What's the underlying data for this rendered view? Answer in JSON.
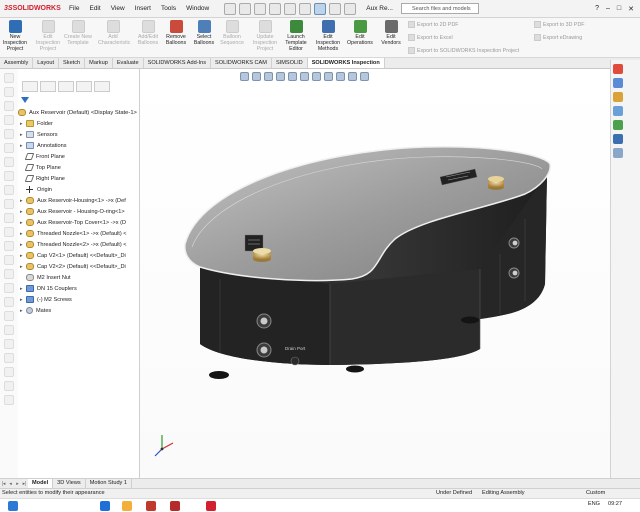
{
  "app": {
    "brand": "SOLIDWORKS",
    "doc_title": "Aux Re..."
  },
  "menu": [
    "File",
    "Edit",
    "View",
    "Insert",
    "Tools",
    "Window"
  ],
  "search": {
    "placeholder": "Search files and models"
  },
  "ribbon": {
    "buttons": [
      {
        "label": "New Inspection Project",
        "enabled": true
      },
      {
        "label": "Edit Inspection Project",
        "enabled": false
      },
      {
        "label": "Create New Template",
        "enabled": false
      },
      {
        "label": "Add Characteristic",
        "enabled": false
      },
      {
        "label": "Add/Edit Balloons",
        "enabled": false
      },
      {
        "label": "Remove Balloons",
        "enabled": true
      },
      {
        "label": "Select Balloons",
        "enabled": true
      },
      {
        "label": "Balloon Sequence",
        "enabled": false
      },
      {
        "label": "Update Inspection Project",
        "enabled": false
      },
      {
        "label": "Launch Template Editor",
        "enabled": true
      },
      {
        "label": "Edit Inspection Methods",
        "enabled": true
      },
      {
        "label": "Edit Operations",
        "enabled": true
      },
      {
        "label": "Edit Vendors",
        "enabled": true
      }
    ],
    "links": [
      "Export to 2D PDF",
      "Export to Excel",
      "Export to SOLIDWORKS Inspection Project",
      "Export to 3D PDF",
      "Export eDrawing"
    ]
  },
  "tabs": [
    "Assembly",
    "Layout",
    "Sketch",
    "Markup",
    "Evaluate",
    "SOLIDWORKS Add-Ins",
    "SOLIDWORKS CAM",
    "SIMSOLID",
    "SOLIDWORKS Inspection"
  ],
  "active_tab": "SOLIDWORKS Inspection",
  "tree": {
    "root": "Aux Reservoir (Default) <Display State-1>",
    "items": [
      {
        "label": "Folder",
        "icon": "folder"
      },
      {
        "label": "Sensors",
        "icon": "sensor"
      },
      {
        "label": "Annotations",
        "icon": "annot"
      },
      {
        "label": "Front Plane",
        "icon": "plane"
      },
      {
        "label": "Top Plane",
        "icon": "plane"
      },
      {
        "label": "Right Plane",
        "icon": "plane"
      },
      {
        "label": "Origin",
        "icon": "origin"
      },
      {
        "label": "Aux Reservoir-Housing<1> ->x (Def",
        "icon": "part"
      },
      {
        "label": "Aux Reservoir - Housing-O-ring<1>",
        "icon": "part"
      },
      {
        "label": "Aux Reservoir-Top Cover<1> ->x (D",
        "icon": "part"
      },
      {
        "label": "Threaded Nozzle<1> ->x (Default) <",
        "icon": "part"
      },
      {
        "label": "Threaded Nozzle<2> ->x (Default) <",
        "icon": "part"
      },
      {
        "label": "Cap V2<1> (Default) <<Default>_Di",
        "icon": "part"
      },
      {
        "label": "Cap V2<2> (Default) <<Default>_Di",
        "icon": "part"
      },
      {
        "label": "M2 Insert Nut",
        "icon": "part-g"
      },
      {
        "label": "DN 15 Couplers",
        "icon": "blue"
      },
      {
        "label": "(-) M2 Screws",
        "icon": "blue"
      },
      {
        "label": "Mates",
        "icon": "mates"
      }
    ]
  },
  "model": {
    "plate_text": "Drain Port"
  },
  "bottom_tabs": [
    "Model",
    "3D Views",
    "Motion Study 1"
  ],
  "active_bottom_tab": "Model",
  "status": {
    "hint": "Select entities to modify their appearance",
    "state1": "Under Defined",
    "state2": "Editing Assembly",
    "units": "Custom"
  },
  "taskbar": {
    "lang": "ENG",
    "time": "09:27"
  },
  "colors": {
    "brand_red": "#d2202f",
    "accent_blue": "#2a6fc0"
  }
}
